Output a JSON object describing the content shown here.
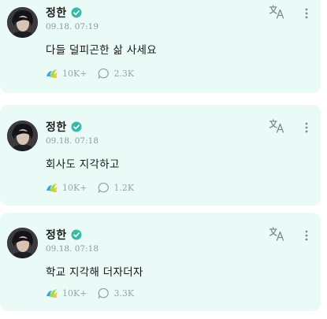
{
  "author": {
    "name": "정한"
  },
  "icons": {
    "verified": "verified-badge-icon",
    "like": "like-wave-icon",
    "comment": "comment-bubble-icon",
    "translate": "translate-icon",
    "more": "more-vertical-icon"
  },
  "colors": {
    "card_background": "#eafbf7",
    "verified": "#3ab9a8",
    "stat_text": "#9aa4a2"
  },
  "posts": [
    {
      "timestamp": "09.18. 07:19",
      "text": "다들 덜피곤한 삶 사세요",
      "likes": "10K+",
      "comments": "2.3K"
    },
    {
      "timestamp": "09.18. 07:18",
      "text": "회사도 지각하고",
      "likes": "10K+",
      "comments": "1.2K"
    },
    {
      "timestamp": "09.18. 07:18",
      "text": "학교 지각해 더자더자",
      "likes": "10K+",
      "comments": "3.3K"
    }
  ]
}
